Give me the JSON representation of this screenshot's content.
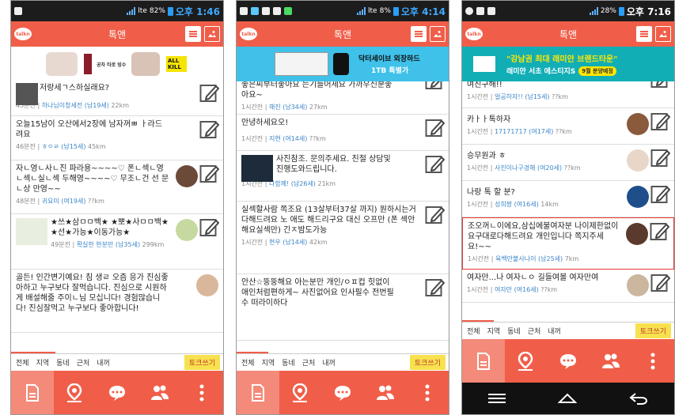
{
  "app": {
    "title": "톡앤",
    "logo": "talkn",
    "talk_button": "토크쓰기"
  },
  "filters": [
    "전체",
    "지역",
    "동네",
    "근처",
    "내꺼"
  ],
  "colors": {
    "accent": "#f05e49",
    "talk_button": "#f7e14e",
    "nick": "#3b86c8",
    "time": "#3fa9ff"
  },
  "phones": [
    {
      "status": {
        "pct": "82%",
        "time": "오후 1:46"
      },
      "banner": {
        "text_a": "공차 타로 빙수",
        "text_b": "ALL KILL"
      },
      "posts": [
        {
          "msg": "저랑세ㄱ스하실래요?",
          "time": "45분전",
          "nick": "하나님이창세전 (남19세)",
          "dist": "22km"
        },
        {
          "msg": "오늘15남이 오산에서2장에 남자꺼ㅃ ㅏ라드려요",
          "time": "46분전",
          "nick": "ㅎㅇㄹ (남15세)",
          "dist": "45km"
        },
        {
          "msg": "자ㄴ영ㄴ사ㄴ진 파라용~~~~♡ 폰ㄴ섹ㄴ영ㄴ섹ㄴ실ㄴ섹 두해영~~~~♡ 무조ㄴ건 선 문ㄴ상 만영~~",
          "time": "48분전",
          "nick": "귀요미 (여19세)",
          "dist": "??km"
        },
        {
          "msg": "★쓰★삼ㅁㅁ백★ ★뽀★사ㅁㅁ백★ ★선★가능★이동가능★",
          "time": "49분전",
          "nick": "확실한 한분만 (남35세)",
          "dist": "299km"
        },
        {
          "msg": "골든! 인간변기예요! 침 생ㄹ 오즘 응가 진심좋아하고 누구보다 잘먹습니다. 진심으로 시원하게 배설해줄 주이ㄴ님 모십니다! 경험많습니다! 진심잘먹고 누구보다 좋아합니다!",
          "time": "",
          "nick": "",
          "dist": ""
        }
      ]
    },
    {
      "status": {
        "pct": "8%",
        "time": "오후 4:14"
      },
      "banner": {
        "text_a": "닥터세이브 외장하드",
        "text_b": "1TB 특별가"
      },
      "posts": [
        {
          "msg": "좋은씨부터좋아요 는기들어세요 가까우신분좋아요~",
          "time": "1시간전",
          "nick": "해진 (남34세)",
          "dist": "27km"
        },
        {
          "msg": "안녕하세요오!",
          "time": "1시간전",
          "nick": "지현 (여14세)",
          "dist": "??km"
        },
        {
          "msg": "사진참조. 문의주세요. 친절 상담및진행도와드립니다.",
          "time": "1시간전",
          "nick": "다함께! (남26세)",
          "dist": "21km"
        },
        {
          "msg": "실섹할사람 쪽조요 (13살부터37살 까지) 원하시는거 다해드려요 노 애도 해드리구요 대신 오프만 (폰 섹안해요실섹만) 긴ㅈ밤도가능",
          "time": "1시간전",
          "nick": "현우 (남14세)",
          "dist": "42km"
        },
        {
          "msg": "안산☆뚱뚱해요 아는분만 개인/ㅇㅍ컵 힛없이 애인처럼편하게~ 사진없어요 인사필수 전번필수 떠라이하다",
          "time": "",
          "nick": "",
          "dist": ""
        }
      ]
    },
    {
      "status": {
        "pct": "28%",
        "time": "오후 7:16"
      },
      "banner": {
        "text_a": "\"강남권 최대 래미안 브랜드타운\"",
        "text_b": "래미안 서초 에스티지S",
        "badge": "9월 분양예정"
      },
      "posts": [
        {
          "msg": "여친구해!!",
          "time": "1시간전",
          "nick": "얼공하자!! (남15세)",
          "dist": "??km"
        },
        {
          "msg": "카ㅏㅏ톡하자",
          "time": "1시간전",
          "nick": "17171717 (여17세)",
          "dist": "??km"
        },
        {
          "msg": "승무원과 ㅎ",
          "time": "1시간전",
          "nick": "사진이나구경해 (여20세)",
          "dist": "??km"
        },
        {
          "msg": "나랑 톡 할 분?",
          "time": "1시간전",
          "nick": "성희짱 (여16세)",
          "dist": "14km"
        },
        {
          "msg": "조오꺼ㄴ이에요,삼십에불여자분 나이제한없이 요구대로다해드려요 개인입니다 쪽지주세요!~~",
          "time": "1시간전",
          "nick": "육백만불사나이 (남25세)",
          "dist": "7km"
        },
        {
          "msg": "여자만...나 여자ㄴㅇ 길들여볼 여자만여",
          "time": "1시간전",
          "nick": "여자만 (여16세)",
          "dist": "??km"
        }
      ]
    }
  ]
}
